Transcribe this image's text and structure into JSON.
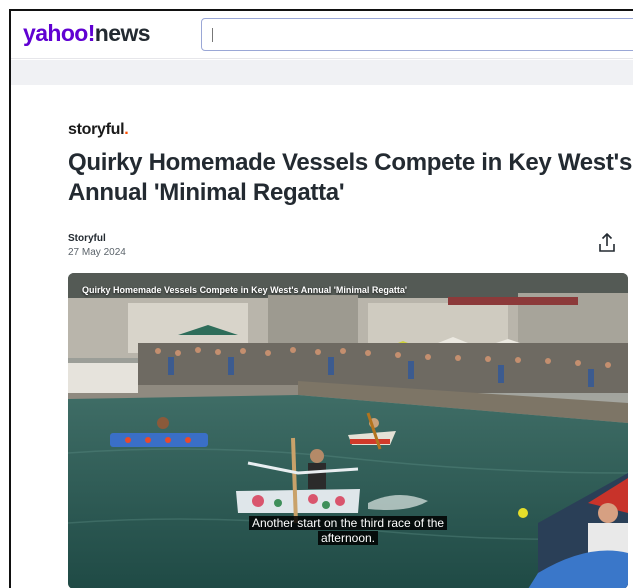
{
  "header": {
    "logo_brand": "yahoo!",
    "logo_section": "news",
    "search": {
      "value": "",
      "placeholder": ""
    }
  },
  "article": {
    "publisher_name": "storyful",
    "publisher_dot": ".",
    "headline": "Quirky Homemade Vessels Compete in Key West's Annual 'Minimal Regatta'",
    "author": "Storyful",
    "date": "27 May 2024"
  },
  "video": {
    "title": "Quirky Homemade Vessels Compete in Key West's Annual 'Minimal Regatta'",
    "caption_line1": "Another start on the third race of the",
    "caption_line2": "afternoon."
  },
  "colors": {
    "brand_purple": "#6001d2",
    "storyful_orange": "#ff4f00",
    "headline": "#232a31",
    "water": "#2f5a55"
  },
  "icons": {
    "share": "share-upload-icon"
  }
}
